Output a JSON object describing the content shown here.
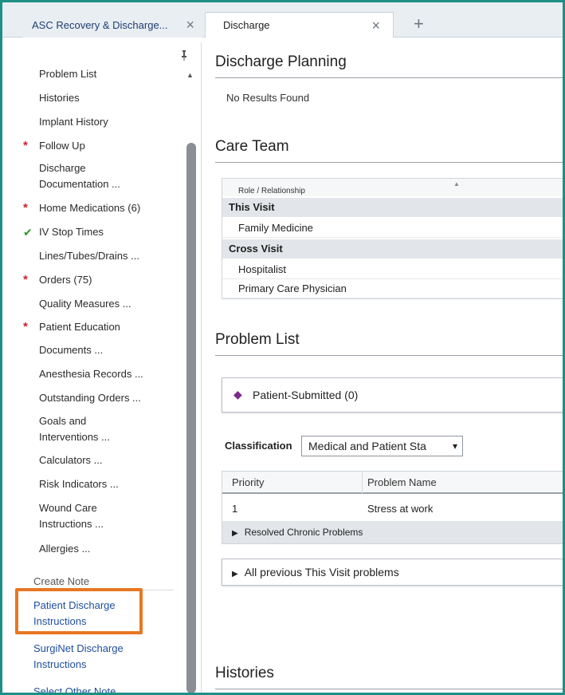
{
  "tabs": [
    {
      "label": "ASC Recovery & Discharge..."
    },
    {
      "label": "Discharge"
    }
  ],
  "icons": {
    "close": "×",
    "new_tab": "+",
    "pin": "pin-icon",
    "required": "*",
    "complete": "✔"
  },
  "sidebar": {
    "items": [
      {
        "label": "Problem List",
        "marker": ""
      },
      {
        "label": "Histories",
        "marker": ""
      },
      {
        "label": "Implant History",
        "marker": ""
      },
      {
        "label": "Follow Up",
        "marker": "required"
      },
      {
        "label": "Discharge\nDocumentation ...",
        "marker": ""
      },
      {
        "label": "Home Medications (6)",
        "marker": "required"
      },
      {
        "label": "IV Stop Times",
        "marker": "complete"
      },
      {
        "label": "Lines/Tubes/Drains ...",
        "marker": ""
      },
      {
        "label": "Orders (75)",
        "marker": "required"
      },
      {
        "label": "Quality Measures ...",
        "marker": ""
      },
      {
        "label": "Patient Education",
        "marker": "required"
      },
      {
        "label": "Documents ...",
        "marker": ""
      },
      {
        "label": "Anesthesia Records ...",
        "marker": ""
      },
      {
        "label": "Outstanding Orders ...",
        "marker": ""
      },
      {
        "label": "Goals and\nInterventions ...",
        "marker": ""
      },
      {
        "label": "Calculators ...",
        "marker": ""
      },
      {
        "label": "Risk Indicators ...",
        "marker": ""
      },
      {
        "label": "Wound Care\nInstructions ...",
        "marker": ""
      },
      {
        "label": "Allergies ...",
        "marker": ""
      }
    ],
    "create_note_label": "Create Note",
    "note_links": [
      {
        "label": "Patient Discharge\nInstructions"
      },
      {
        "label": "SurgiNet Discharge\nInstructions"
      },
      {
        "label": "Select Other Note"
      }
    ],
    "highlight_color": "#e87722"
  },
  "main": {
    "discharge_planning": {
      "title": "Discharge Planning",
      "empty_text": "No Results Found"
    },
    "care_team": {
      "title": "Care Team",
      "column_header": "Role / Relationship",
      "groups": [
        {
          "name": "This Visit",
          "rows": [
            "Family Medicine"
          ]
        },
        {
          "name": "Cross Visit",
          "rows": [
            "Hospitalist",
            "Primary Care Physician"
          ]
        }
      ]
    },
    "problem_list": {
      "title": "Problem List",
      "patient_submitted": "Patient-Submitted (0)",
      "classification_label": "Classification",
      "classification_value": "Medical and Patient Sta",
      "columns": [
        "Priority",
        "Problem Name"
      ],
      "rows": [
        {
          "priority": "1",
          "problem": "Stress at work"
        }
      ],
      "resolved_label": "Resolved Chronic Problems",
      "previous_label": "All previous This Visit problems"
    },
    "histories": {
      "title": "Histories"
    }
  },
  "colors": {
    "accent_border": "#1d8f86",
    "required": "#d1202e",
    "complete": "#2a9a2f",
    "link": "#1f4e9a",
    "diamond": "#7b2a8a"
  }
}
